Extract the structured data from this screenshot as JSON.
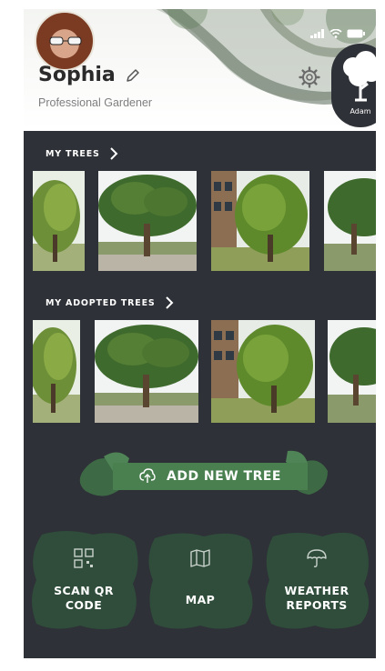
{
  "profile": {
    "name": "Sophia",
    "role": "Professional Gardener"
  },
  "logo": {
    "text": "Adam"
  },
  "sections": {
    "my_trees": "MY TREES",
    "my_adopted_trees": "MY ADOPTED TREES"
  },
  "actions": {
    "add_new_tree": "ADD NEW TREE"
  },
  "tiles": {
    "scan_qr": "SCAN QR\nCODE",
    "map": "MAP",
    "weather": "WEATHER\nREPORTS"
  },
  "icons": [
    "edit-pencil-icon",
    "gear-icon",
    "chevron-right-icon",
    "tree-upload-icon",
    "qr-code-icon",
    "map-icon",
    "umbrella-icon"
  ],
  "colors": {
    "background": "#2e3137",
    "accent_green": "#4a7f50",
    "leaf_dark": "#2f4d3a"
  }
}
